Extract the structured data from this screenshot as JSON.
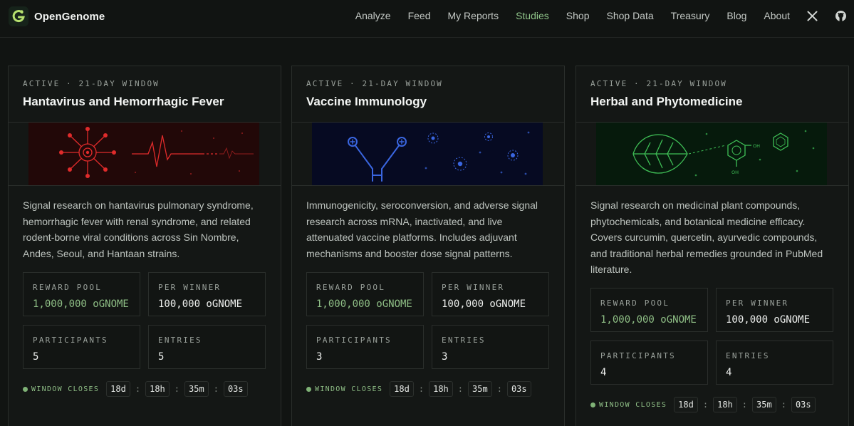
{
  "brand": {
    "name": "OpenGenome"
  },
  "nav": {
    "links": [
      "Analyze",
      "Feed",
      "My Reports",
      "Studies",
      "Shop",
      "Shop Data",
      "Treasury",
      "Blog",
      "About"
    ],
    "active": "Studies",
    "icons": [
      "x-icon",
      "github-icon"
    ]
  },
  "stat_labels": {
    "reward_pool": "REWARD POOL",
    "per_winner": "PER WINNER",
    "participants": "PARTICIPANTS",
    "entries": "ENTRIES",
    "window_closes": "WINDOW CLOSES"
  },
  "colors": {
    "accent": "#8fc489",
    "hantavirus_art": "#e02b2b",
    "vaccine_art": "#3a66e0",
    "herbal_art": "#3fbf56"
  },
  "studies": [
    {
      "status": "ACTIVE · 21-DAY WINDOW",
      "title": "Hantavirus and Hemorrhagic Fever",
      "art_icon": "virus-heartbeat-illustration",
      "description": "Signal research on hantavirus pulmonary syndrome, hemorrhagic fever with renal syndrome, and related rodent-borne viral conditions across Sin Nombre, Andes, Seoul, and Hantaan strains.",
      "reward_pool": "1,000,000 oGNOME",
      "per_winner": "100,000 oGNOME",
      "participants": "5",
      "entries": "5",
      "countdown": {
        "days": "18d",
        "hours": "18h",
        "minutes": "35m",
        "seconds": "03s"
      }
    },
    {
      "status": "ACTIVE · 21-DAY WINDOW",
      "title": "Vaccine Immunology",
      "art_icon": "antibody-illustration",
      "description": "Immunogenicity, seroconversion, and adverse signal research across mRNA, inactivated, and live attenuated vaccine platforms. Includes adjuvant mechanisms and booster dose signal patterns.",
      "reward_pool": "1,000,000 oGNOME",
      "per_winner": "100,000 oGNOME",
      "participants": "3",
      "entries": "3",
      "countdown": {
        "days": "18d",
        "hours": "18h",
        "minutes": "35m",
        "seconds": "03s"
      }
    },
    {
      "status": "ACTIVE · 21-DAY WINDOW",
      "title": "Herbal and Phytomedicine",
      "art_icon": "leaf-molecule-illustration",
      "description": "Signal research on medicinal plant compounds, phytochemicals, and botanical medicine efficacy. Covers curcumin, quercetin, ayurvedic compounds, and traditional herbal remedies grounded in PubMed literature.",
      "art_text": {
        "oh1": "OH",
        "oh2": "OH"
      },
      "reward_pool": "1,000,000 oGNOME",
      "per_winner": "100,000 oGNOME",
      "participants": "4",
      "entries": "4",
      "countdown": {
        "days": "18d",
        "hours": "18h",
        "minutes": "35m",
        "seconds": "03s"
      }
    }
  ]
}
